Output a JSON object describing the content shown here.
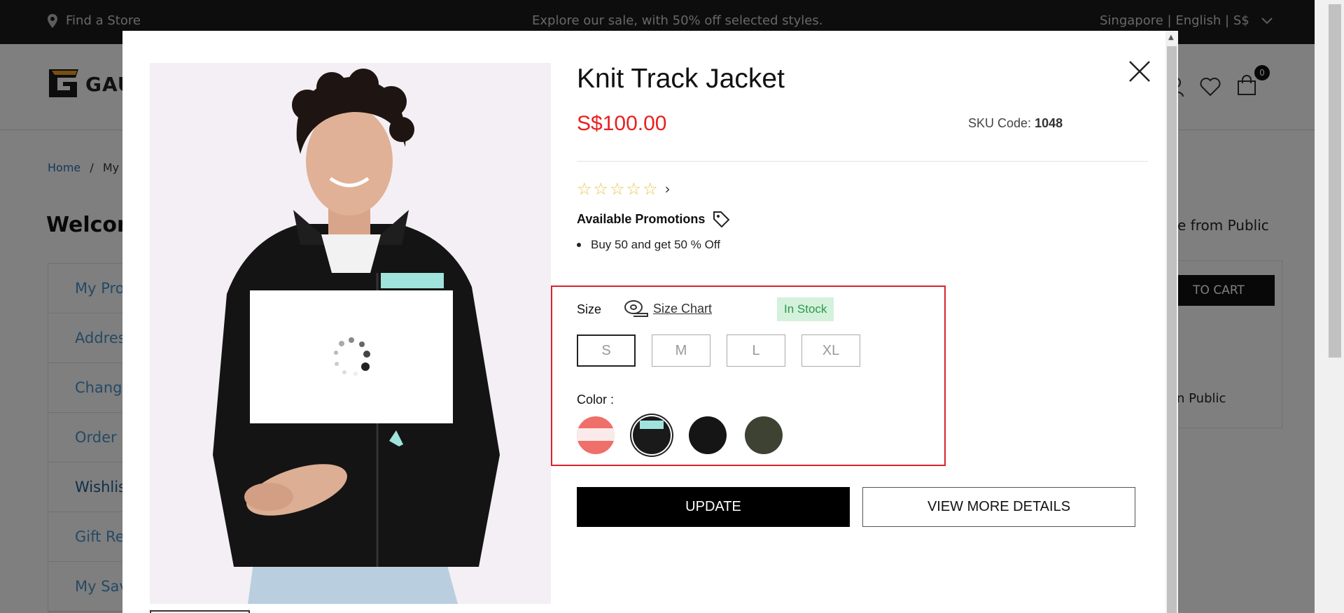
{
  "topbar": {
    "store_label": "Find a Store",
    "promo_text": "Explore our sale, with 50% off selected styles.",
    "locale_text": "Singapore | English | S$"
  },
  "header": {
    "logo_text": "GAU",
    "cart_count": "0"
  },
  "page": {
    "breadcrumb_home": "Home",
    "breadcrumb_sep": "/",
    "breadcrumb_current": "My A",
    "welcome": "Welcom",
    "right_heading": "e from Public",
    "right_card_button": "TO CART",
    "right_card_text": "n Public",
    "side_menu": [
      {
        "label": "My Prof"
      },
      {
        "label": "Addres"
      },
      {
        "label": "Chang"
      },
      {
        "label": "Order H"
      },
      {
        "label": "Wishlis"
      },
      {
        "label": "Gift Reg"
      },
      {
        "label": "My Sav"
      }
    ]
  },
  "modal": {
    "title": "Knit Track Jacket",
    "price": "S$100.00",
    "sku_label": "SKU Code:",
    "sku_value": "1048",
    "rating_stars": 0,
    "promotions_heading": "Available Promotions",
    "promotions": [
      "Buy 50 and get 50 % Off"
    ],
    "size_label": "Size",
    "size_chart_label": "Size Chart",
    "stock_status": "In Stock",
    "sizes": [
      "S",
      "M",
      "L",
      "XL"
    ],
    "selected_size": "S",
    "color_label": "Color :",
    "colors": [
      {
        "name": "coral-white",
        "hex": "#ef6f6a"
      },
      {
        "name": "black-mint",
        "hex": "#1a1a1a"
      },
      {
        "name": "black",
        "hex": "#151515"
      },
      {
        "name": "olive",
        "hex": "#3d4233"
      }
    ],
    "selected_color": "black-mint",
    "update_button": "UPDATE",
    "details_button": "VIEW MORE DETAILS"
  },
  "colors": {
    "topbar_bg": "#1b1b1b",
    "price_red": "#e8211f",
    "highlight_red": "#d9232d",
    "stock_green": "#2b9a4a",
    "star_yellow": "#e8c547"
  }
}
